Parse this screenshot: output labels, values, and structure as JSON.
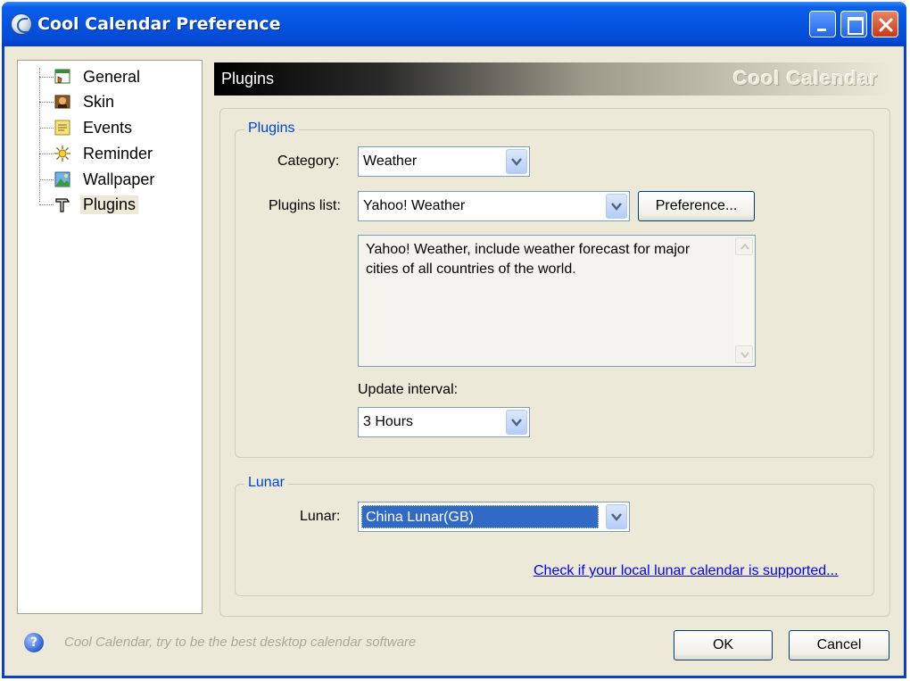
{
  "window": {
    "title": "Cool Calendar Preference"
  },
  "tree": {
    "items": [
      {
        "label": "General",
        "icon": "general-icon",
        "selected": false
      },
      {
        "label": "Skin",
        "icon": "skin-icon",
        "selected": false
      },
      {
        "label": "Events",
        "icon": "events-icon",
        "selected": false
      },
      {
        "label": "Reminder",
        "icon": "reminder-icon",
        "selected": false
      },
      {
        "label": "Wallpaper",
        "icon": "wallpaper-icon",
        "selected": false
      },
      {
        "label": "Plugins",
        "icon": "plugins-icon",
        "selected": true
      }
    ]
  },
  "header": {
    "title": "Plugins",
    "brand": "Cool Calendar"
  },
  "plugins_group": {
    "title": "Plugins",
    "category_label": "Category:",
    "category_value": "Weather",
    "plugins_list_label": "Plugins list:",
    "plugins_list_value": "Yahoo! Weather",
    "preference_button": "Preference...",
    "description": "Yahoo! Weather, include weather forecast for major cities of all countries of the world.",
    "update_interval_label": "Update interval:",
    "update_interval_value": "3 Hours"
  },
  "lunar_group": {
    "title": "Lunar",
    "lunar_label": "Lunar:",
    "lunar_value": "China Lunar(GB)",
    "check_link": "Check if your local lunar calendar is supported..."
  },
  "footer": {
    "tagline": "Cool Calendar, try to be the best desktop calendar software",
    "ok_button": "OK",
    "cancel_button": "Cancel"
  },
  "colors": {
    "titlebar": "#0554e3",
    "dialog_bg": "#ece9d8",
    "group_title": "#0046d5",
    "selection": "#316ac5",
    "link": "#0000ff"
  }
}
